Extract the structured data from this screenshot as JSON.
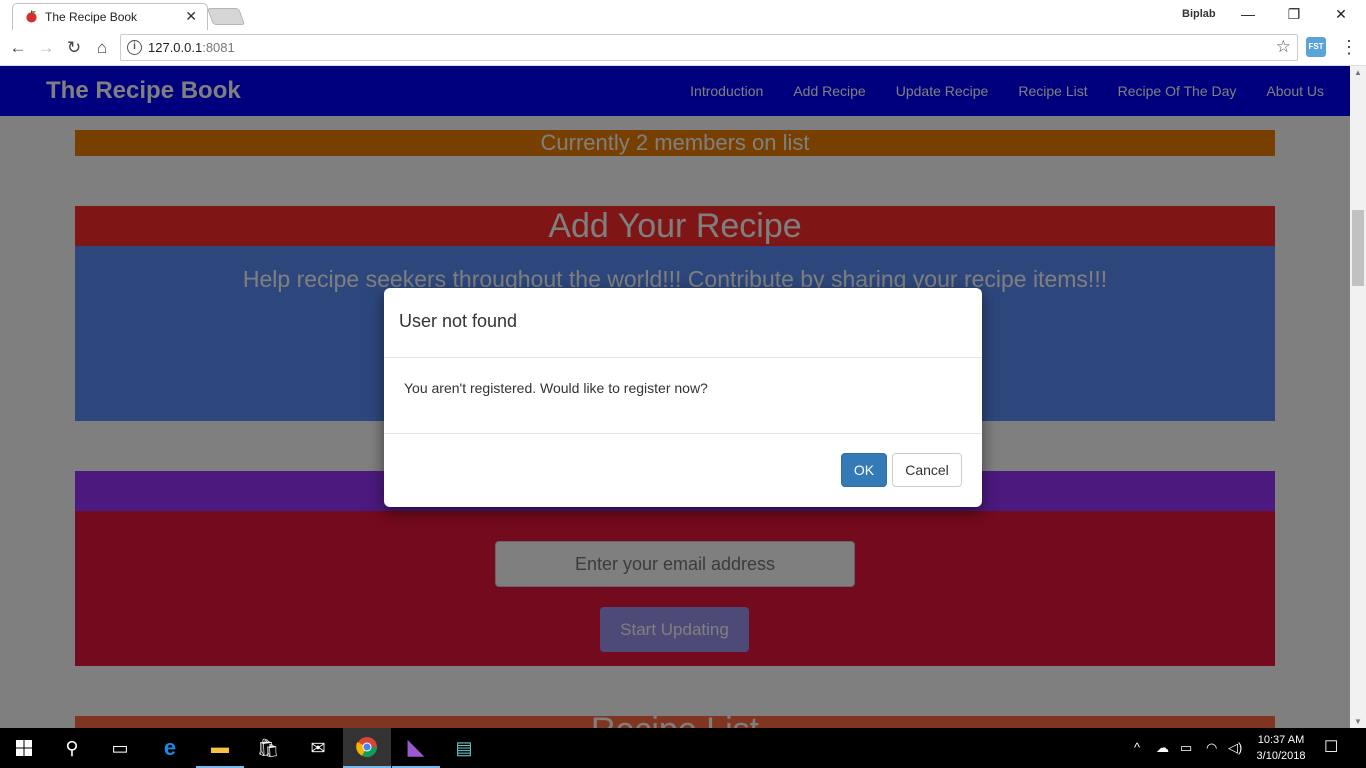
{
  "browser": {
    "tab_title": "The Recipe Book",
    "profile_name": "Biplab",
    "url_host": "127.0.0.1",
    "url_port": ":8081",
    "extension_label": "FST"
  },
  "page": {
    "brand": "The Recipe Book",
    "nav": [
      "Introduction",
      "Add Recipe",
      "Update Recipe",
      "Recipe List",
      "Recipe Of The Day",
      "About Us"
    ],
    "members_banner": "Currently 2 members on list",
    "add_section": {
      "title": "Add Your Recipe",
      "subtitle": "Help recipe seekers throughout the world!!! Contribute by sharing your recipe items!!!"
    },
    "update_section": {
      "email_placeholder": "Enter your email address",
      "start_button": "Start Updating"
    },
    "list_section": {
      "title": "Recipe List"
    }
  },
  "modal": {
    "title": "User not found",
    "message": "You aren't registered. Would like to register now?",
    "ok_label": "OK",
    "cancel_label": "Cancel"
  },
  "taskbar": {
    "time": "10:37 AM",
    "date": "3/10/2018"
  },
  "colors": {
    "navbar": "#0000ff",
    "members_banner": "#f08000",
    "add_header": "#ff2a2a",
    "add_body": "#5b8ff8",
    "update_header": "#9933ff",
    "update_body": "#e8153a",
    "list_header": "#ff6a40",
    "primary_button": "#337ab7"
  }
}
